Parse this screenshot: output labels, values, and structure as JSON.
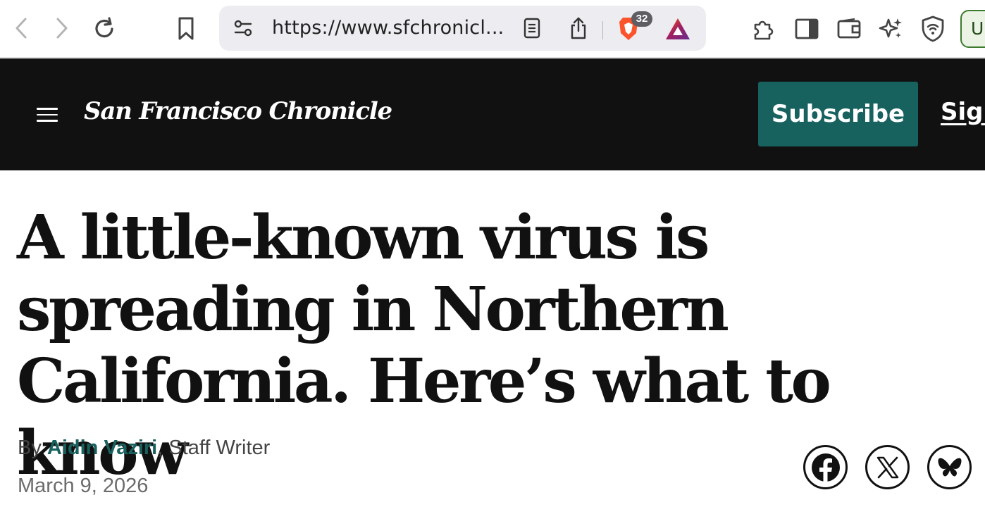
{
  "browser": {
    "url": "https://www.sfchronicl...",
    "shields_count": "32",
    "profile_initial": "U",
    "icons": [
      "back-icon",
      "forward-icon",
      "reload-icon",
      "bookmark-icon",
      "site-settings-icon",
      "reader-mode-icon",
      "share-icon",
      "brave-shields-icon",
      "brave-rewards-icon",
      "extensions-icon",
      "sidebar-icon",
      "wallet-icon",
      "leo-ai-icon",
      "vpn-icon"
    ]
  },
  "header": {
    "logo": "San Francisco Chronicle",
    "subscribe_label": "Subscribe",
    "signin_label": "Sign"
  },
  "article": {
    "headline": "A little-known virus is spreading in Northern California. Here’s what to know",
    "byline_prefix": "By",
    "author": "Aidin Vaziri",
    "separator": ",",
    "role": "Staff Writer",
    "date": "March 9, 2026"
  },
  "share": {
    "icons": [
      "facebook-icon",
      "x-icon",
      "bluesky-icon"
    ]
  },
  "colors": {
    "header_bg": "#111111",
    "accent_teal": "#17615f",
    "profile_border": "#3c7a2e"
  }
}
